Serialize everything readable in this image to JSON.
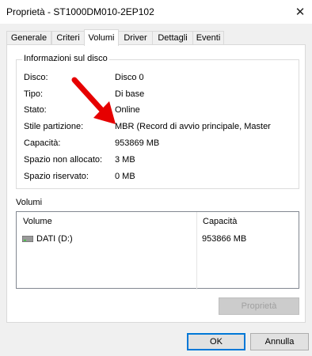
{
  "window": {
    "title": "Proprietà - ST1000DM010-2EP102",
    "close_glyph": "✕"
  },
  "tabs": [
    {
      "label": "Generale",
      "active": false
    },
    {
      "label": "Criteri",
      "active": false
    },
    {
      "label": "Volumi",
      "active": true
    },
    {
      "label": "Driver",
      "active": false
    },
    {
      "label": "Dettagli",
      "active": false
    },
    {
      "label": "Eventi",
      "active": false
    }
  ],
  "disk_info": {
    "group_title": "Informazioni sul disco",
    "rows": [
      {
        "label": "Disco:",
        "value": "Disco 0"
      },
      {
        "label": "Tipo:",
        "value": "Di base"
      },
      {
        "label": "Stato:",
        "value": "Online"
      },
      {
        "label": "Stile partizione:",
        "value": "MBR (Record di avvio principale, Master"
      },
      {
        "label": "Capacità:",
        "value": "953869 MB"
      },
      {
        "label": "Spazio non allocato:",
        "value": "3 MB"
      },
      {
        "label": "Spazio riservato:",
        "value": "0 MB"
      }
    ]
  },
  "volumes": {
    "group_title": "Volumi",
    "columns": [
      "Volume",
      "Capacità"
    ],
    "rows": [
      {
        "volume": "DATI (D:)",
        "capacity": "953866 MB",
        "icon": "drive-icon"
      }
    ],
    "properties_button": "Proprietà"
  },
  "annotation": {
    "arrow_color": "#e60000",
    "icon": "red-arrow"
  },
  "footer": {
    "ok_label": "OK",
    "cancel_label": "Annulla"
  }
}
